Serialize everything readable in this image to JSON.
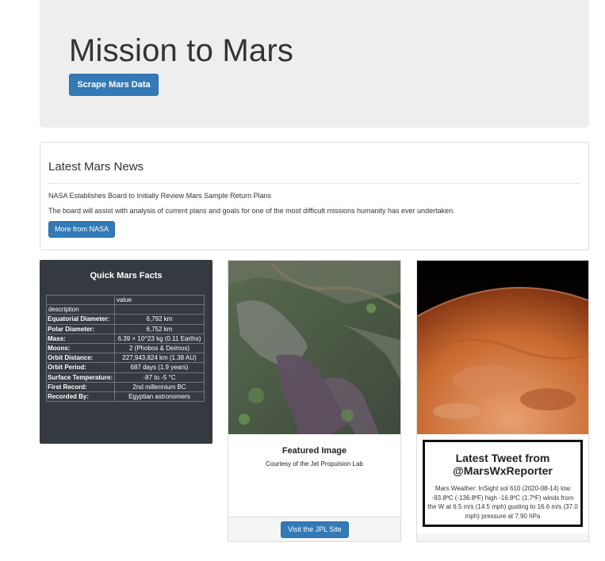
{
  "jumbotron": {
    "title": "Mission to Mars",
    "scrape_button": "Scrape Mars Data"
  },
  "news": {
    "heading": "Latest Mars News",
    "title": "NASA Establishes Board to Initially Review Mars Sample Return Plans",
    "teaser": "The board will assist with analysis of current plans and goals for one of the most difficult missions humanity has ever undertaken.",
    "button": "More from NASA"
  },
  "facts": {
    "title": "Quick Mars Facts",
    "value_header": "value",
    "index_header": "description",
    "rows": [
      {
        "label": "Equatorial Diameter:",
        "value": "6,792 km"
      },
      {
        "label": "Polar Diameter:",
        "value": "6,752 km"
      },
      {
        "label": "Mass:",
        "value": "6.39 × 10^23 kg (0.11 Earths)"
      },
      {
        "label": "Moons:",
        "value": "2 (Phobos & Deimos)"
      },
      {
        "label": "Orbit Distance:",
        "value": "227,943,824 km (1.38 AU)"
      },
      {
        "label": "Orbit Period:",
        "value": "687 days (1.9 years)"
      },
      {
        "label": "Surface Temperature:",
        "value": "-87 to -5 °C"
      },
      {
        "label": "First Record:",
        "value": "2nd millennium BC"
      },
      {
        "label": "Recorded By:",
        "value": "Egyptian astronomers"
      }
    ]
  },
  "featured_image": {
    "title": "Featured Image",
    "caption": "Courtesy of the Jet Propulsion Lab",
    "button": "Visit the JPL Site"
  },
  "weather": {
    "heading": "Latest Tweet from @MarsWxReporter",
    "tweet": "Mars Weather: InSight sol 610 (2020-08-14) low -93.8ºC (-136.8ºF) high -16.8ºC (1.7ºF) winds from the W at 6.5 m/s (14.5 mph) gusting to 16.6 m/s (37.0 mph) pressure at 7.90 hPa"
  },
  "colors": {
    "primary": "#337ab7",
    "jumbotron_bg": "#eeeeee",
    "facts_bg": "#343a40"
  }
}
